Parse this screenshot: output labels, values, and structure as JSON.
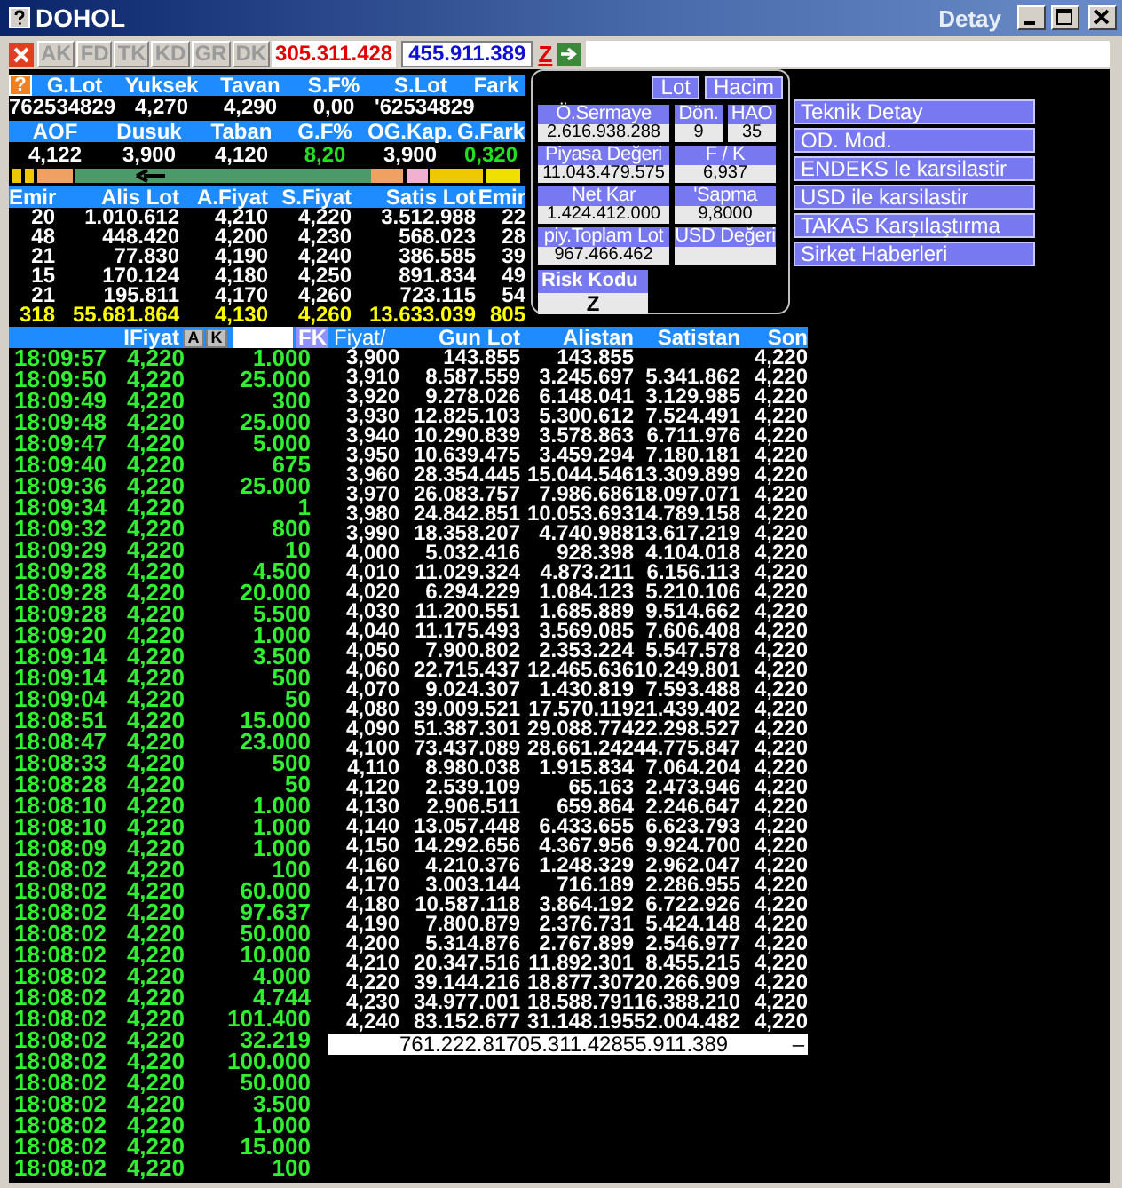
{
  "window": {
    "title": "DOHOL",
    "subtitle": "Detay"
  },
  "toolbar": {
    "tabs": [
      {
        "label": "AK",
        "disabled": true
      },
      {
        "label": "FD",
        "disabled": true
      },
      {
        "label": "TK",
        "disabled": true
      },
      {
        "label": "KD",
        "disabled": true
      },
      {
        "label": "GR",
        "disabled": true
      },
      {
        "label": "DK",
        "disabled": true
      }
    ],
    "buy_total": "305.311.428",
    "sell_total": "455.911.389",
    "risk_label": "Z"
  },
  "summary": {
    "help_label": "?",
    "header1": [
      "G.Lot",
      "Yuksek",
      "Tavan",
      "S.F%",
      "S.Lot",
      "Fark"
    ],
    "row1": [
      "762534829",
      "4,270",
      "4,290",
      "0,00",
      "'62534829"
    ],
    "header2": [
      "AOF",
      "Dusuk",
      "Taban",
      "G.F%",
      "OG.Kap.",
      "G.Fark"
    ],
    "row2": [
      {
        "text": "4,122",
        "positive": false
      },
      {
        "text": "3,900",
        "positive": false
      },
      {
        "text": "4,120",
        "positive": false
      },
      {
        "text": "8,20",
        "positive": true
      },
      {
        "text": "3,900",
        "positive": false
      },
      {
        "text": "0,320",
        "positive": true
      }
    ]
  },
  "depth": {
    "columns": [
      "Emir",
      "Alis Lot",
      "A.Fiyat",
      "S.Fiyat",
      "Satis Lot",
      "Emir"
    ],
    "rows": [
      [
        "20",
        "1.010.612",
        "4,210",
        "4,220",
        "3.512.988",
        "22"
      ],
      [
        "48",
        "448.420",
        "4,200",
        "4,230",
        "568.023",
        "28"
      ],
      [
        "21",
        "77.830",
        "4,190",
        "4,240",
        "386.585",
        "39"
      ],
      [
        "15",
        "170.124",
        "4,180",
        "4,250",
        "891.834",
        "49"
      ],
      [
        "21",
        "195.811",
        "4,170",
        "4,260",
        "723.115",
        "54"
      ]
    ],
    "total": [
      "318",
      "55.681.864",
      "4,130",
      "4,260",
      "13.633.039",
      "805"
    ]
  },
  "info": {
    "buttons": [
      "Lot",
      "Hacim"
    ],
    "fields": [
      {
        "label": "Ö.Sermaye",
        "value": "2.616.938.288",
        "kind": "wide"
      },
      {
        "label": "Dön.",
        "value": "9",
        "kind": "small"
      },
      {
        "label": "HAO",
        "value": "35",
        "kind": "small"
      },
      {
        "label": "Piyasa Değeri",
        "value": "11.043.479.575",
        "kind": "wide"
      },
      {
        "label": "F / K",
        "value": "6,937",
        "kind": "half"
      },
      {
        "label": "Net Kar",
        "value": "1.424.412.000",
        "kind": "wide"
      },
      {
        "label": "'Sapma",
        "value": "9,8000",
        "kind": "half"
      },
      {
        "label": "piy.Toplam Lot",
        "value": "967.466.462",
        "kind": "wide"
      },
      {
        "label": "USD Değeri",
        "kind": "half"
      }
    ],
    "risk": {
      "label": "Risk Kodu",
      "value": "Z"
    }
  },
  "menu": [
    "Teknik Detay",
    "OD. Mod.",
    "ENDEKS le karsilastir",
    "USD ile karsilastir",
    "TAKAS Karşılaştırma",
    "Sirket Haberleri"
  ],
  "trades": {
    "header": "IFiyat",
    "buttons": [
      "A",
      "K"
    ],
    "filter_button": "FK",
    "rows": [
      {
        "time": "18:09:57",
        "price": "4,220",
        "lot": "1.000"
      },
      {
        "time": "18:09:50",
        "price": "4,220",
        "lot": "25.000"
      },
      {
        "time": "18:09:49",
        "price": "4,220",
        "lot": "300"
      },
      {
        "time": "18:09:48",
        "price": "4,220",
        "lot": "25.000"
      },
      {
        "time": "18:09:47",
        "price": "4,220",
        "lot": "5.000"
      },
      {
        "time": "18:09:40",
        "price": "4,220",
        "lot": "675"
      },
      {
        "time": "18:09:36",
        "price": "4,220",
        "lot": "25.000"
      },
      {
        "time": "18:09:34",
        "price": "4,220",
        "lot": "1"
      },
      {
        "time": "18:09:32",
        "price": "4,220",
        "lot": "800"
      },
      {
        "time": "18:09:29",
        "price": "4,220",
        "lot": "10"
      },
      {
        "time": "18:09:28",
        "price": "4,220",
        "lot": "4.500"
      },
      {
        "time": "18:09:28",
        "price": "4,220",
        "lot": "20.000"
      },
      {
        "time": "18:09:28",
        "price": "4,220",
        "lot": "5.500"
      },
      {
        "time": "18:09:20",
        "price": "4,220",
        "lot": "1.000"
      },
      {
        "time": "18:09:14",
        "price": "4,220",
        "lot": "3.500"
      },
      {
        "time": "18:09:14",
        "price": "4,220",
        "lot": "500"
      },
      {
        "time": "18:09:04",
        "price": "4,220",
        "lot": "50"
      },
      {
        "time": "18:08:51",
        "price": "4,220",
        "lot": "15.000"
      },
      {
        "time": "18:08:47",
        "price": "4,220",
        "lot": "23.000"
      },
      {
        "time": "18:08:33",
        "price": "4,220",
        "lot": "500"
      },
      {
        "time": "18:08:28",
        "price": "4,220",
        "lot": "50"
      },
      {
        "time": "18:08:10",
        "price": "4,220",
        "lot": "1.000"
      },
      {
        "time": "18:08:10",
        "price": "4,220",
        "lot": "1.000"
      },
      {
        "time": "18:08:09",
        "price": "4,220",
        "lot": "1.000"
      },
      {
        "time": "18:08:02",
        "price": "4,220",
        "lot": "100"
      },
      {
        "time": "18:08:02",
        "price": "4,220",
        "lot": "60.000"
      },
      {
        "time": "18:08:02",
        "price": "4,220",
        "lot": "97.637"
      },
      {
        "time": "18:08:02",
        "price": "4,220",
        "lot": "50.000"
      },
      {
        "time": "18:08:02",
        "price": "4,220",
        "lot": "10.000"
      },
      {
        "time": "18:08:02",
        "price": "4,220",
        "lot": "4.000"
      },
      {
        "time": "18:08:02",
        "price": "4,220",
        "lot": "4.744"
      },
      {
        "time": "18:08:02",
        "price": "4,220",
        "lot": "101.400"
      },
      {
        "time": "18:08:02",
        "price": "4,220",
        "lot": "32.219"
      },
      {
        "time": "18:08:02",
        "price": "4,220",
        "lot": "100.000"
      },
      {
        "time": "18:08:02",
        "price": "4,220",
        "lot": "50.000"
      },
      {
        "time": "18:08:02",
        "price": "4,220",
        "lot": "3.500"
      },
      {
        "time": "18:08:02",
        "price": "4,220",
        "lot": "1.000"
      },
      {
        "time": "18:08:02",
        "price": "4,220",
        "lot": "15.000"
      },
      {
        "time": "18:08:02",
        "price": "4,220",
        "lot": "100"
      }
    ]
  },
  "price_table": {
    "columns": [
      "Fiyat/",
      "Gun Lot",
      "Alistan",
      "Satistan",
      "Son"
    ],
    "rows": [
      [
        "3,900",
        "143.855",
        "143.855",
        "",
        "4,220"
      ],
      [
        "3,910",
        "8.587.559",
        "3.245.697",
        "5.341.862",
        "4,220"
      ],
      [
        "3,920",
        "9.278.026",
        "6.148.041",
        "3.129.985",
        "4,220"
      ],
      [
        "3,930",
        "12.825.103",
        "5.300.612",
        "7.524.491",
        "4,220"
      ],
      [
        "3,940",
        "10.290.839",
        "3.578.863",
        "6.711.976",
        "4,220"
      ],
      [
        "3,950",
        "10.639.475",
        "3.459.294",
        "7.180.181",
        "4,220"
      ],
      [
        "3,960",
        "28.354.445",
        "15.044.546",
        "13.309.899",
        "4,220"
      ],
      [
        "3,970",
        "26.083.757",
        "7.986.686",
        "18.097.071",
        "4,220"
      ],
      [
        "3,980",
        "24.842.851",
        "10.053.693",
        "14.789.158",
        "4,220"
      ],
      [
        "3,990",
        "18.358.207",
        "4.740.988",
        "13.617.219",
        "4,220"
      ],
      [
        "4,000",
        "5.032.416",
        "928.398",
        "4.104.018",
        "4,220"
      ],
      [
        "4,010",
        "11.029.324",
        "4.873.211",
        "6.156.113",
        "4,220"
      ],
      [
        "4,020",
        "6.294.229",
        "1.084.123",
        "5.210.106",
        "4,220"
      ],
      [
        "4,030",
        "11.200.551",
        "1.685.889",
        "9.514.662",
        "4,220"
      ],
      [
        "4,040",
        "11.175.493",
        "3.569.085",
        "7.606.408",
        "4,220"
      ],
      [
        "4,050",
        "7.900.802",
        "2.353.224",
        "5.547.578",
        "4,220"
      ],
      [
        "4,060",
        "22.715.437",
        "12.465.636",
        "10.249.801",
        "4,220"
      ],
      [
        "4,070",
        "9.024.307",
        "1.430.819",
        "7.593.488",
        "4,220"
      ],
      [
        "4,080",
        "39.009.521",
        "17.570.119",
        "21.439.402",
        "4,220"
      ],
      [
        "4,090",
        "51.387.301",
        "29.088.774",
        "22.298.527",
        "4,220"
      ],
      [
        "4,100",
        "73.437.089",
        "28.661.242",
        "44.775.847",
        "4,220"
      ],
      [
        "4,110",
        "8.980.038",
        "1.915.834",
        "7.064.204",
        "4,220"
      ],
      [
        "4,120",
        "2.539.109",
        "65.163",
        "2.473.946",
        "4,220"
      ],
      [
        "4,130",
        "2.906.511",
        "659.864",
        "2.246.647",
        "4,220"
      ],
      [
        "4,140",
        "13.057.448",
        "6.433.655",
        "6.623.793",
        "4,220"
      ],
      [
        "4,150",
        "14.292.656",
        "4.367.956",
        "9.924.700",
        "4,220"
      ],
      [
        "4,160",
        "4.210.376",
        "1.248.329",
        "2.962.047",
        "4,220"
      ],
      [
        "4,170",
        "3.003.144",
        "716.189",
        "2.286.955",
        "4,220"
      ],
      [
        "4,180",
        "10.587.118",
        "3.864.192",
        "6.722.926",
        "4,220"
      ],
      [
        "4,190",
        "7.800.879",
        "2.376.731",
        "5.424.148",
        "4,220"
      ],
      [
        "4,200",
        "5.314.876",
        "2.767.899",
        "2.546.977",
        "4,220"
      ],
      [
        "4,210",
        "20.347.516",
        "11.892.301",
        "8.455.215",
        "4,220"
      ],
      [
        "4,220",
        "39.144.216",
        "18.877.307",
        "20.266.909",
        "4,220"
      ],
      [
        "4,230",
        "34.977.001",
        "18.588.791",
        "16.388.210",
        "4,220"
      ],
      [
        "4,240",
        "83.152.677",
        "31.148.195",
        "52.004.482",
        "4,220"
      ]
    ],
    "totals": [
      "761.222.817",
      "05.311.428",
      "55.911.389",
      "–"
    ]
  }
}
